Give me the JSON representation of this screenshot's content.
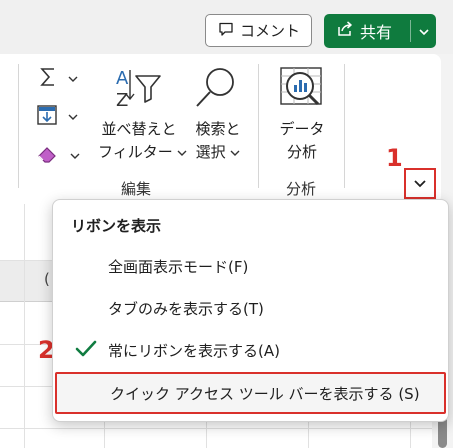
{
  "header": {
    "comment_label": "コメント",
    "share_label": "共有"
  },
  "ribbon": {
    "sort_filter_line1": "並べ替えと",
    "sort_filter_line2": "フィルター",
    "find_select_line1": "検索と",
    "find_select_line2": "選択",
    "data_analysis_line1": "データ",
    "data_analysis_line2": "分析",
    "group_editing": "編集",
    "group_analysis": "分析"
  },
  "annotations": {
    "step1": "1",
    "step2": "2"
  },
  "sheet": {
    "partial_header_text": "("
  },
  "menu": {
    "title": "リボンを表示",
    "items": [
      {
        "label": "全画面表示モード(F)",
        "checked": false
      },
      {
        "label": "タブのみを表示する(T)",
        "checked": false
      },
      {
        "label": "常にリボンを表示する(A)",
        "checked": true
      },
      {
        "label": "クイック アクセス ツール バーを表示する (S)",
        "checked": false
      }
    ]
  },
  "colors": {
    "accent_green": "#0f7b3e",
    "highlight_red": "#d9302b",
    "check_green": "#107c41"
  }
}
